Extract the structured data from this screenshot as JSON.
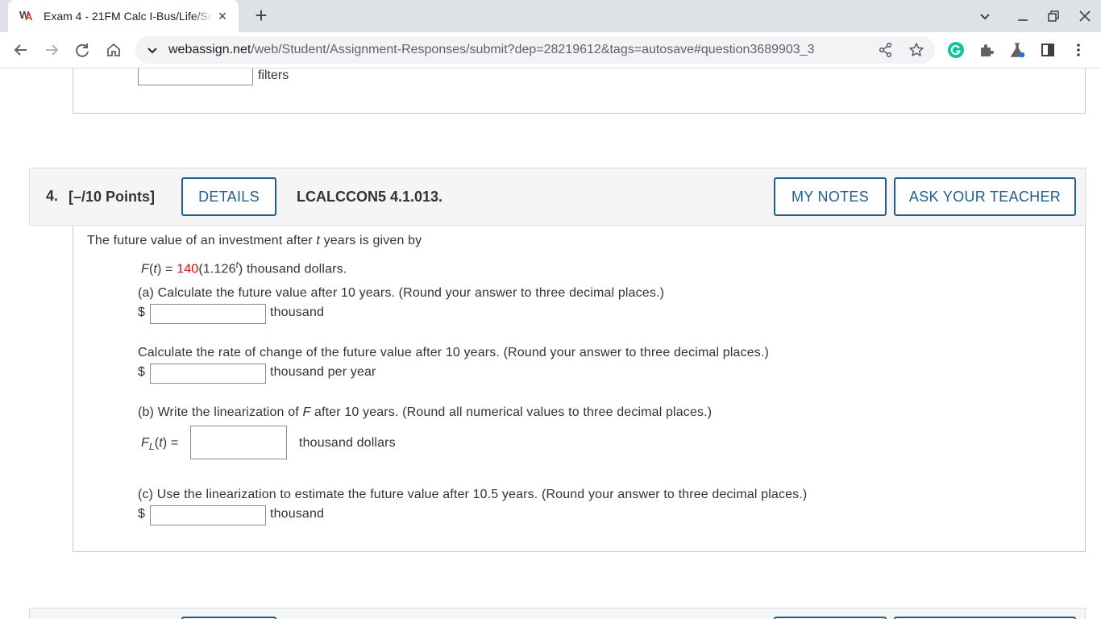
{
  "browser": {
    "tab_title": "Exam 4 - 21FM Calc I-Bus/Life/Soc",
    "url_host": "webassign.net",
    "url_path": "/web/Student/Assignment-Responses/submit?dep=28219612&tags=autosave#question3689903_3"
  },
  "previous_question": {
    "unit_label": "filters"
  },
  "question": {
    "number": "4.",
    "points": "[–/10 Points]",
    "details_label": "DETAILS",
    "code": "LCALCCON5 4.1.013.",
    "my_notes_label": "MY NOTES",
    "ask_teacher_label": "ASK YOUR TEACHER",
    "intro_prefix": "The future value of an investment after ",
    "intro_var": "t",
    "intro_suffix": " years is given by",
    "formula": {
      "lhs_fn": "F",
      "lhs_open": "(",
      "lhs_var": "t",
      "lhs_close": ") = ",
      "coefficient": "140",
      "base_open": "(1.126",
      "exponent": "t",
      "base_close": ")",
      "unit": " thousand dollars."
    },
    "part_a": {
      "prompt": "(a) Calculate the future value after 10 years. (Round your answer to three decimal places.)",
      "currency": "$",
      "unit": "thousand",
      "value": ""
    },
    "part_a2": {
      "prompt": "Calculate the rate of change of the future value after 10 years. (Round your answer to three decimal places.)",
      "currency": "$",
      "unit": "thousand per year",
      "value": ""
    },
    "part_b": {
      "prompt_prefix": "(b) Write the linearization of ",
      "prompt_var": "F",
      "prompt_suffix": " after 10 years. (Round all numerical values to three decimal places.)",
      "lhs_fn": "F",
      "lhs_sub": "L",
      "lhs_open": "(",
      "lhs_var": "t",
      "lhs_close": ") =",
      "unit": "thousand dollars",
      "value": ""
    },
    "part_c": {
      "prompt": "(c) Use the linearization to estimate the future value after 10.5 years. (Round your answer to three decimal places.)",
      "currency": "$",
      "unit": "thousand",
      "value": ""
    }
  }
}
